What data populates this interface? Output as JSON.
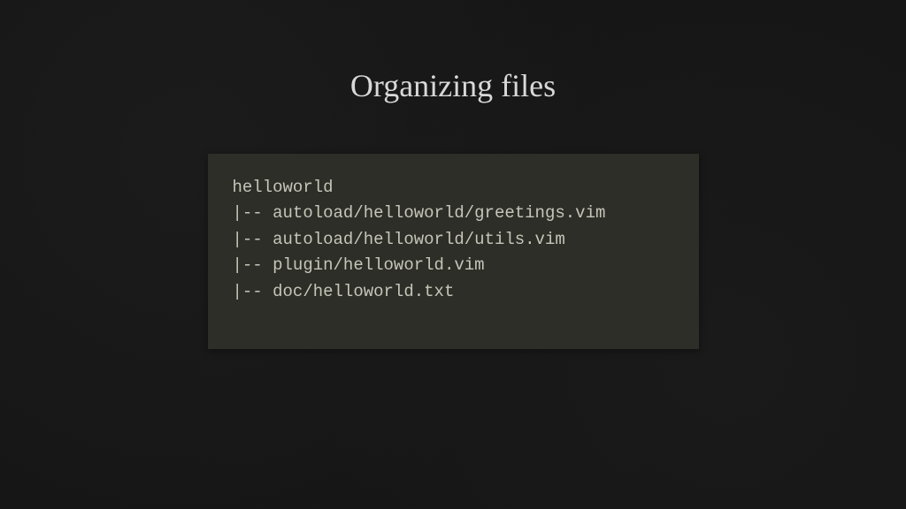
{
  "slide": {
    "title": "Organizing files",
    "code": {
      "lines": [
        "helloworld",
        "|-- autoload/helloworld/greetings.vim",
        "|-- autoload/helloworld/utils.vim",
        "|-- plugin/helloworld.vim",
        "|-- doc/helloworld.txt"
      ]
    }
  }
}
